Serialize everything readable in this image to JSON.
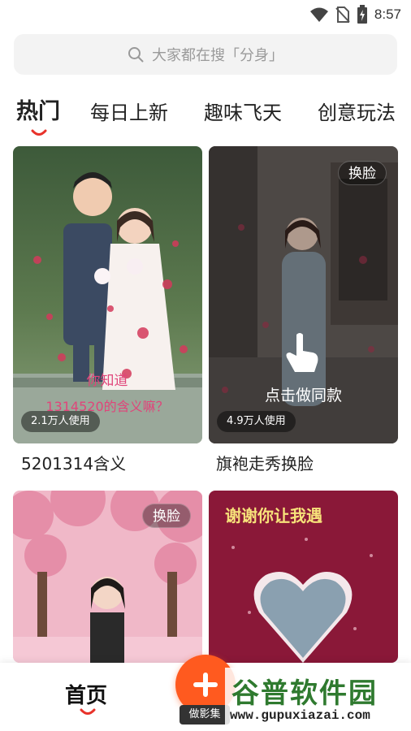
{
  "status_bar": {
    "time": "8:57",
    "icons": [
      "wifi-icon",
      "no-sim-icon",
      "battery-icon"
    ]
  },
  "search": {
    "placeholder": "大家都在搜「分身」"
  },
  "tabs": [
    {
      "label": "热门",
      "active": true
    },
    {
      "label": "每日上新",
      "active": false
    },
    {
      "label": "趣味飞天",
      "active": false
    },
    {
      "label": "创意玩法",
      "active": false
    }
  ],
  "cards": [
    {
      "title": "5201314含义",
      "usage": "2.1万人使用",
      "caption_line1": "你知道",
      "caption_line2": "1314520的含义嘛？"
    },
    {
      "title": "旗袍走秀换脸",
      "usage": "4.9万人使用",
      "badge": "换脸",
      "tap_hint": "点击做同款"
    },
    {
      "badge": "换脸"
    },
    {
      "banner": "谢谢你让我遇"
    }
  ],
  "bottom_nav": {
    "home": "首页",
    "create_label": "做影集"
  },
  "watermark": {
    "title": "谷普软件园",
    "url": "www.gupuxiazai.com"
  },
  "colors": {
    "accent": "#ff5a1f",
    "underline": "#e8322a",
    "watermark_green": "#2f7a2f"
  }
}
